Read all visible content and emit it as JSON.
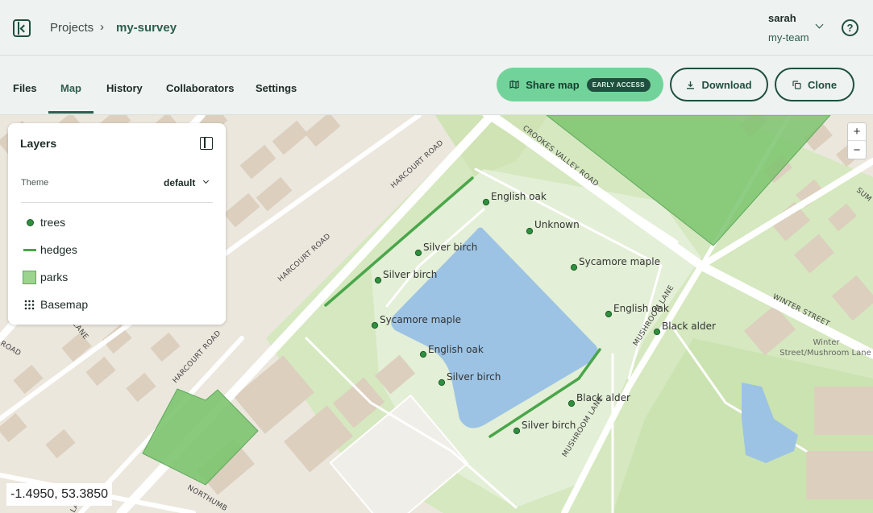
{
  "header": {
    "breadcrumb": {
      "projects": "Projects",
      "separator": "›",
      "project": "my-survey"
    },
    "user": {
      "name": "sarah",
      "team": "my-team"
    },
    "help": "?"
  },
  "tabs": [
    {
      "label": "Files"
    },
    {
      "label": "Map",
      "active": true
    },
    {
      "label": "History"
    },
    {
      "label": "Collaborators"
    },
    {
      "label": "Settings"
    }
  ],
  "actions": {
    "share_label": "Share map",
    "share_badge": "EARLY ACCESS",
    "download_label": "Download",
    "clone_label": "Clone"
  },
  "layers_panel": {
    "title": "Layers",
    "theme_label": "Theme",
    "theme_value": "default",
    "layers": [
      {
        "label": "trees",
        "symbol": "dot",
        "color": "#2f8f3f"
      },
      {
        "label": "hedges",
        "symbol": "line",
        "color": "#4aa64a"
      },
      {
        "label": "parks",
        "symbol": "polygon",
        "color": "#9bd48e"
      },
      {
        "label": "Basemap",
        "symbol": "grid-icon",
        "color": "#1d2b26"
      }
    ]
  },
  "map": {
    "zoom_in": "+",
    "zoom_out": "−",
    "coordinates": "-1.4950, 53.3850",
    "tree_labels": [
      "English oak",
      "Unknown",
      "Silver birch",
      "Sycamore maple",
      "Silver birch",
      "English oak",
      "Black alder",
      "Sycamore maple",
      "English oak",
      "Silver birch",
      "Black alder",
      "Silver birch"
    ],
    "road_labels": {
      "crookes_valley": "CROOKES VALLEY ROAD",
      "harcourt_1": "HARCOURT ROAD",
      "harcourt_2": "HARCOURT ROAD",
      "harcourt_3": "HARCOURT ROAD",
      "winter_street": "WINTER STREET",
      "mushroom_lane_1": "MUSHROOM LANE",
      "mushroom_lane_2": "MUSHROOM LANE",
      "northumberland": "NORTHUMB",
      "sum": "SUM",
      "lane_left": "LANE",
      "road_left": "ROAD",
      "lane_bottom": "LANE"
    },
    "place_label_1": "Winter",
    "place_label_2": "Street/Mushroom Lane",
    "colors": {
      "water": "#9cc3e4",
      "park": "#cfe6b8",
      "park_polygon": "#7cc46f",
      "building": "#d9cdbd",
      "tree": "#2f8f3f",
      "hedge": "#4aa64a"
    }
  }
}
